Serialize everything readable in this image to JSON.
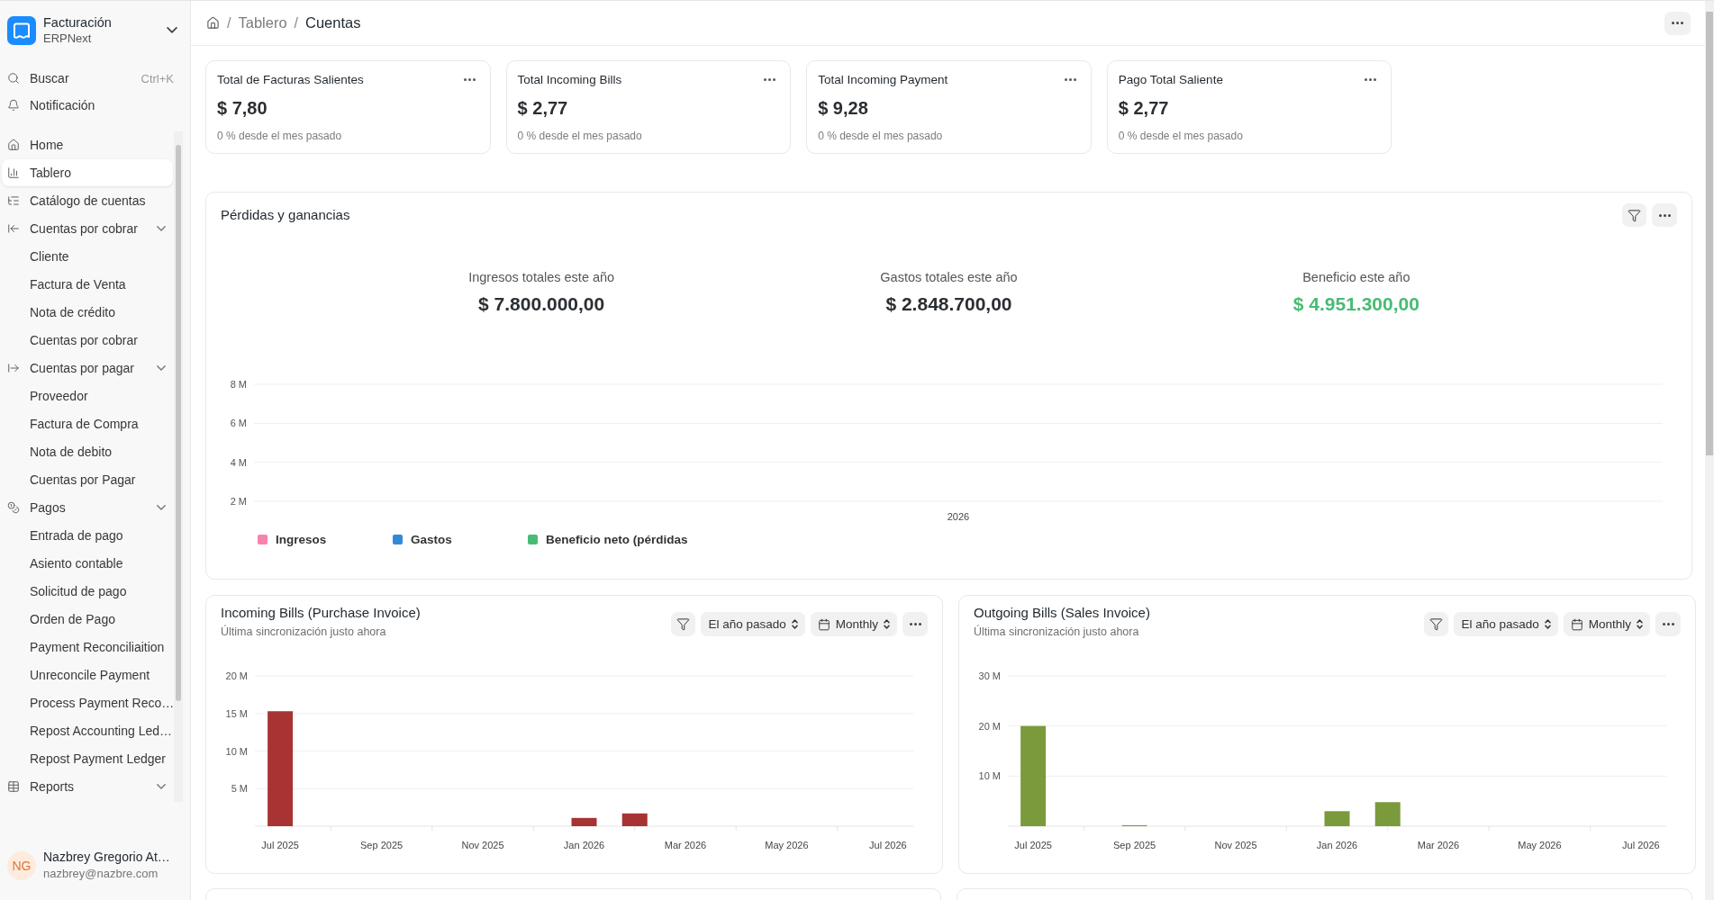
{
  "sidebar": {
    "app": {
      "title": "Facturación",
      "subtitle": "ERPNext"
    },
    "search": {
      "label": "Buscar",
      "shortcut": "Ctrl+K"
    },
    "notifications": {
      "label": "Notificación"
    },
    "items": [
      {
        "label": "Home",
        "selected": false,
        "expandable": false
      },
      {
        "label": "Tablero",
        "selected": true,
        "expandable": false
      },
      {
        "label": "Catálogo de cuentas",
        "selected": false,
        "expandable": false
      },
      {
        "label": "Cuentas por cobrar",
        "selected": false,
        "expandable": true,
        "children": [
          {
            "label": "Cliente",
            "selected": false
          },
          {
            "label": "Factura de Venta",
            "selected": false
          },
          {
            "label": "Nota de crédito",
            "selected": false
          },
          {
            "label": "Cuentas por cobrar",
            "selected": false
          }
        ]
      },
      {
        "label": "Cuentas por pagar",
        "selected": false,
        "expandable": true,
        "children": [
          {
            "label": "Proveedor",
            "selected": false
          },
          {
            "label": "Factura de Compra",
            "selected": false
          },
          {
            "label": "Nota de debito",
            "selected": false
          },
          {
            "label": "Cuentas por Pagar",
            "selected": false
          }
        ]
      },
      {
        "label": "Pagos",
        "selected": false,
        "expandable": true,
        "children": [
          {
            "label": "Entrada de pago",
            "selected": false
          },
          {
            "label": "Asiento contable",
            "selected": false
          },
          {
            "label": "Solicitud de pago",
            "selected": false
          },
          {
            "label": "Orden de Pago",
            "selected": false
          },
          {
            "label": "Payment Reconciliaition",
            "selected": false
          },
          {
            "label": "Unreconcile Payment",
            "selected": false
          },
          {
            "label": "Process Payment Reco…",
            "selected": false
          },
          {
            "label": "Repost Accounting Led…",
            "selected": false
          },
          {
            "label": "Repost Payment Ledger",
            "selected": false
          }
        ]
      },
      {
        "label": "Reports",
        "selected": false,
        "expandable": true
      }
    ],
    "user": {
      "initials": "NG",
      "name": "Nazbrey Gregorio At…",
      "email": "nazbrey@nazbre.com"
    }
  },
  "breadcrumb": [
    {
      "separator": "/",
      "label": "Tablero",
      "current": false
    },
    {
      "separator": "/",
      "label": "Cuentas",
      "current": true
    }
  ],
  "cards": [
    {
      "title": "Total de Facturas Salientes",
      "value": "$ 7,80",
      "note": "0 % desde el mes pasado"
    },
    {
      "title": "Total Incoming Bills",
      "value": "$ 2,77",
      "note": "0 % desde el mes pasado"
    },
    {
      "title": "Total Incoming Payment",
      "value": "$ 9,28",
      "note": "0 % desde el mes pasado"
    },
    {
      "title": "Pago Total Saliente",
      "value": "$ 2,77",
      "note": "0 % desde el mes pasado"
    }
  ],
  "profit_loss": {
    "title": "Pérdidas y ganancias",
    "summary": [
      {
        "label": "Ingresos totales este año",
        "value": "$ 7.800.000,00",
        "color": "#2b2f33"
      },
      {
        "label": "Gastos totales este año",
        "value": "$ 2.848.700,00",
        "color": "#2b2f33"
      },
      {
        "label": "Beneficio este año",
        "value": "$ 4.951.300,00",
        "color": "#48bb74"
      }
    ],
    "chart_data": {
      "type": "bar",
      "categories": [
        "2026"
      ],
      "yticks": [
        {
          "value": 2000000,
          "label": "2 M"
        },
        {
          "value": 4000000,
          "label": "4 M"
        },
        {
          "value": 6000000,
          "label": "6 M"
        },
        {
          "value": 8000000,
          "label": "8 M"
        }
      ],
      "ylim": [
        0,
        8000000
      ],
      "grid": true,
      "series": [
        {
          "name": "Ingresos",
          "color": "#f683ae",
          "values": [
            null
          ]
        },
        {
          "name": "Gastos",
          "color": "#318ad8",
          "values": [
            null
          ]
        },
        {
          "name": "Beneficio neto (pérdidas",
          "color": "#48bb74",
          "values": [
            null
          ]
        }
      ]
    }
  },
  "bill_charts": [
    {
      "title": "Incoming Bills (Purchase Invoice)",
      "subtitle": "Última sincronización justo ahora",
      "period": "El año pasado",
      "interval": "Monthly",
      "chart_data": {
        "type": "bar",
        "categories": [
          "Jul 2025",
          null,
          "Sep 2025",
          null,
          "Nov 2025",
          null,
          "Jan 2026",
          null,
          "Mar 2026",
          null,
          "May 2026",
          null,
          "Jul 2026"
        ],
        "yticks": [
          {
            "value": 5000000,
            "label": "5 M"
          },
          {
            "value": 10000000,
            "label": "10 M"
          },
          {
            "value": 15000000,
            "label": "15 M"
          },
          {
            "value": 20000000,
            "label": "20 M"
          }
        ],
        "ylim": [
          0,
          20000000
        ],
        "grid": true,
        "series": [
          {
            "color": "#a83333",
            "values": [
              15300000,
              0,
              0,
              0,
              0,
              0,
              1100000,
              1700000,
              0,
              0,
              0,
              0,
              0
            ]
          }
        ]
      }
    },
    {
      "title": "Outgoing Bills (Sales Invoice)",
      "subtitle": "Última sincronización justo ahora",
      "period": "El año pasado",
      "interval": "Monthly",
      "chart_data": {
        "type": "bar",
        "categories": [
          "Jul 2025",
          null,
          "Sep 2025",
          null,
          "Nov 2025",
          null,
          "Jan 2026",
          null,
          "Mar 2026",
          null,
          "May 2026",
          null,
          "Jul 2026"
        ],
        "yticks": [
          {
            "value": 10000000,
            "label": "10 M"
          },
          {
            "value": 20000000,
            "label": "20 M"
          },
          {
            "value": 30000000,
            "label": "30 M"
          }
        ],
        "ylim": [
          0,
          30000000
        ],
        "grid": true,
        "series": [
          {
            "color": "#7b9a3c",
            "values": [
              20000000,
              0,
              200000,
              0,
              0,
              0,
              3000000,
              4800000,
              0,
              0,
              0,
              0,
              0
            ]
          }
        ]
      }
    }
  ]
}
